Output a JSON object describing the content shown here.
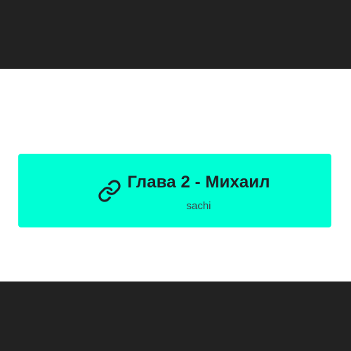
{
  "link_card": {
    "title": "Глава 2 - Михаил",
    "subtitle": "sachi",
    "icon": "link-icon",
    "background": "#00ffd5",
    "text_color": "#1f2326"
  },
  "page": {
    "letterbox_color": "#222222",
    "content_background": "#ffffff"
  }
}
